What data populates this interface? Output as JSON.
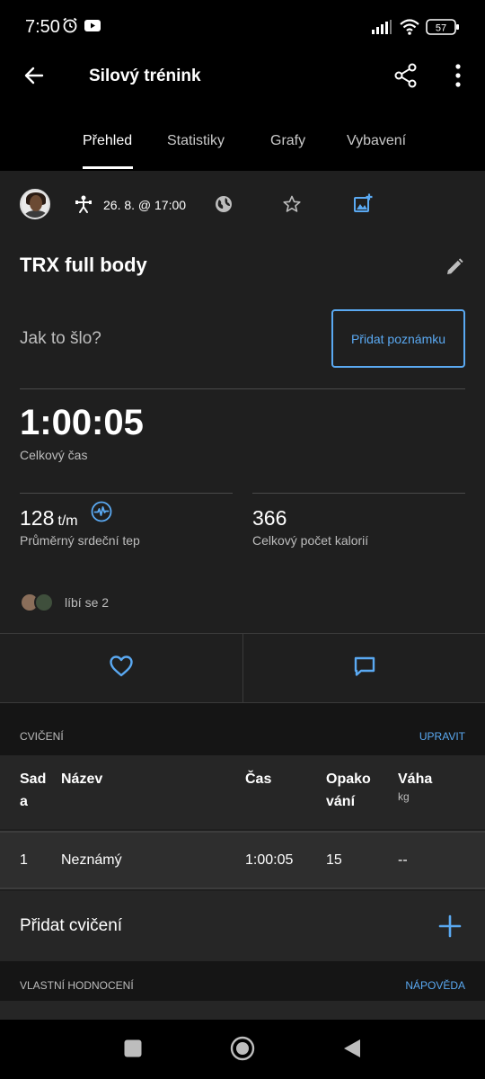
{
  "status_bar": {
    "time": "7:50",
    "battery": "57"
  },
  "app_bar": {
    "title": "Silový trénink"
  },
  "tabs": [
    {
      "label": "Přehled",
      "active": true
    },
    {
      "label": "Statistiky",
      "active": false
    },
    {
      "label": "Grafy",
      "active": false
    },
    {
      "label": "Vybavení",
      "active": false
    }
  ],
  "activity": {
    "date": "26. 8. @ 17:00",
    "title": "TRX full body",
    "note_prompt": "Jak to šlo?",
    "add_note_label": "Přidat poznámku"
  },
  "stats": {
    "total_time": "1:00:05",
    "total_time_label": "Celkový čas",
    "avg_hr": "128",
    "avg_hr_unit": "t/m",
    "avg_hr_label": "Průměrný srdeční tep",
    "calories": "366",
    "calories_label": "Celkový počet kalorií"
  },
  "likes": {
    "text": "líbí se 2"
  },
  "exercises_section": {
    "title": "CVIČENÍ",
    "action": "UPRAVIT",
    "columns": [
      {
        "label": "Sad\na",
        "sub": ""
      },
      {
        "label": "Název",
        "sub": ""
      },
      {
        "label": "Čas",
        "sub": ""
      },
      {
        "label": "Opako\nvání",
        "sub": ""
      },
      {
        "label": "Váha",
        "sub": "kg"
      }
    ],
    "rows": [
      {
        "set": "1",
        "name": "Neznámý",
        "time": "1:00:05",
        "reps": "15",
        "weight": "--"
      }
    ],
    "add_label": "Přidat cvičení"
  },
  "rating_section": {
    "title": "VLASTNÍ HODNOCENÍ",
    "action": "NÁPOVĚDA"
  },
  "colors": {
    "accent": "#5aa9f2",
    "background": "#1f1f1f",
    "header": "#000000"
  },
  "icons": {
    "back": "arrow-left-icon",
    "share": "share-icon",
    "menu": "more-vert-icon",
    "activity_type": "strength-training-icon",
    "privacy": "globe-icon",
    "favorite": "star-icon",
    "add_photo": "add-photo-icon",
    "edit": "pencil-icon",
    "heart_rate": "heart-rate-icon",
    "like": "heart-icon",
    "comment": "comment-icon",
    "add": "plus-icon"
  }
}
